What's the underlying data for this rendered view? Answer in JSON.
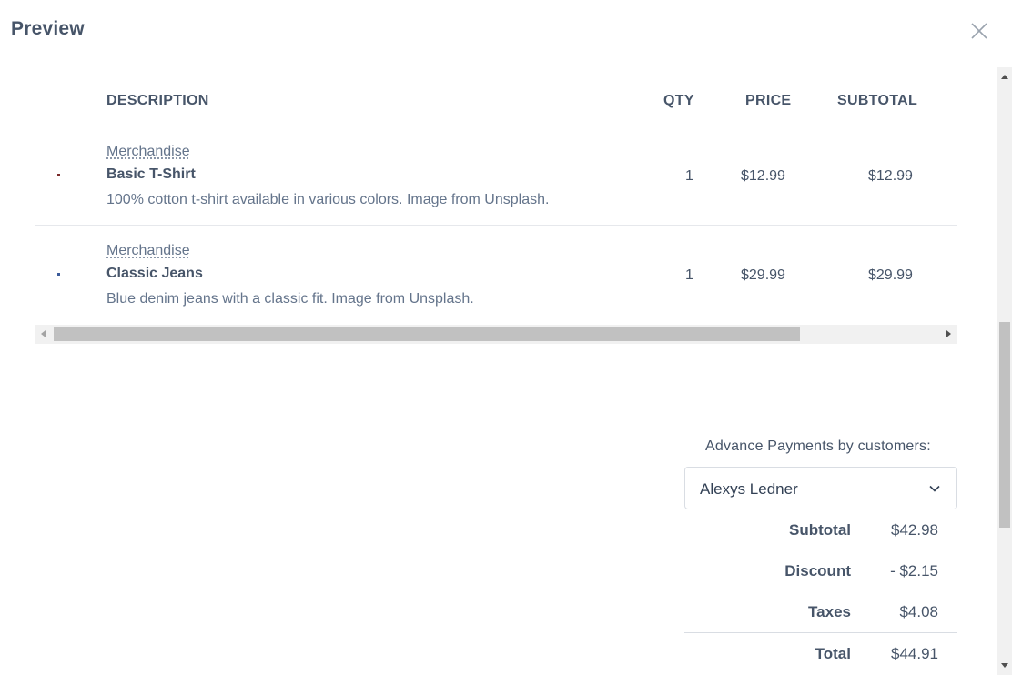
{
  "dialog": {
    "title": "Preview"
  },
  "table": {
    "headers": {
      "description": "DESCRIPTION",
      "qty": "QTY",
      "price": "PRICE",
      "subtotal": "SUBTOTAL"
    },
    "rows": [
      {
        "category": "Merchandise",
        "name": "Basic T-Shirt",
        "description": "100% cotton t-shirt available in various colors. Image from Unsplash.",
        "qty": "1",
        "price": "$12.99",
        "subtotal": "$12.99"
      },
      {
        "category": "Merchandise",
        "name": "Classic Jeans",
        "description": "Blue denim jeans with a classic fit. Image from Unsplash.",
        "qty": "1",
        "price": "$29.99",
        "subtotal": "$29.99"
      }
    ]
  },
  "summary": {
    "advance_label": "Advance Payments by customers:",
    "customer_selected": "Alexys Ledner",
    "subtotal_label": "Subtotal",
    "subtotal_value": "$42.98",
    "discount_label": "Discount",
    "discount_value": "- $2.15",
    "taxes_label": "Taxes",
    "taxes_value": "$4.08",
    "total_label": "Total",
    "total_value": "$44.91"
  },
  "icons": {
    "close": "close-icon",
    "dropdown": "chevron-down-icon"
  },
  "colors": {
    "text": "#475569",
    "muted": "#64748b",
    "border": "#d9dde3"
  }
}
